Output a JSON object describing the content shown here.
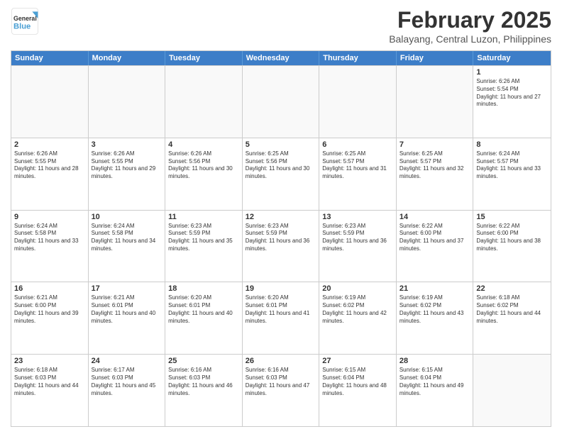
{
  "header": {
    "logo_general": "General",
    "logo_blue": "Blue",
    "main_title": "February 2025",
    "subtitle": "Balayang, Central Luzon, Philippines"
  },
  "days_of_week": [
    "Sunday",
    "Monday",
    "Tuesday",
    "Wednesday",
    "Thursday",
    "Friday",
    "Saturday"
  ],
  "weeks": [
    [
      {
        "day": "",
        "info": ""
      },
      {
        "day": "",
        "info": ""
      },
      {
        "day": "",
        "info": ""
      },
      {
        "day": "",
        "info": ""
      },
      {
        "day": "",
        "info": ""
      },
      {
        "day": "",
        "info": ""
      },
      {
        "day": "1",
        "info": "Sunrise: 6:26 AM\nSunset: 5:54 PM\nDaylight: 11 hours and 27 minutes."
      }
    ],
    [
      {
        "day": "2",
        "info": "Sunrise: 6:26 AM\nSunset: 5:55 PM\nDaylight: 11 hours and 28 minutes."
      },
      {
        "day": "3",
        "info": "Sunrise: 6:26 AM\nSunset: 5:55 PM\nDaylight: 11 hours and 29 minutes."
      },
      {
        "day": "4",
        "info": "Sunrise: 6:26 AM\nSunset: 5:56 PM\nDaylight: 11 hours and 30 minutes."
      },
      {
        "day": "5",
        "info": "Sunrise: 6:25 AM\nSunset: 5:56 PM\nDaylight: 11 hours and 30 minutes."
      },
      {
        "day": "6",
        "info": "Sunrise: 6:25 AM\nSunset: 5:57 PM\nDaylight: 11 hours and 31 minutes."
      },
      {
        "day": "7",
        "info": "Sunrise: 6:25 AM\nSunset: 5:57 PM\nDaylight: 11 hours and 32 minutes."
      },
      {
        "day": "8",
        "info": "Sunrise: 6:24 AM\nSunset: 5:57 PM\nDaylight: 11 hours and 33 minutes."
      }
    ],
    [
      {
        "day": "9",
        "info": "Sunrise: 6:24 AM\nSunset: 5:58 PM\nDaylight: 11 hours and 33 minutes."
      },
      {
        "day": "10",
        "info": "Sunrise: 6:24 AM\nSunset: 5:58 PM\nDaylight: 11 hours and 34 minutes."
      },
      {
        "day": "11",
        "info": "Sunrise: 6:23 AM\nSunset: 5:59 PM\nDaylight: 11 hours and 35 minutes."
      },
      {
        "day": "12",
        "info": "Sunrise: 6:23 AM\nSunset: 5:59 PM\nDaylight: 11 hours and 36 minutes."
      },
      {
        "day": "13",
        "info": "Sunrise: 6:23 AM\nSunset: 5:59 PM\nDaylight: 11 hours and 36 minutes."
      },
      {
        "day": "14",
        "info": "Sunrise: 6:22 AM\nSunset: 6:00 PM\nDaylight: 11 hours and 37 minutes."
      },
      {
        "day": "15",
        "info": "Sunrise: 6:22 AM\nSunset: 6:00 PM\nDaylight: 11 hours and 38 minutes."
      }
    ],
    [
      {
        "day": "16",
        "info": "Sunrise: 6:21 AM\nSunset: 6:00 PM\nDaylight: 11 hours and 39 minutes."
      },
      {
        "day": "17",
        "info": "Sunrise: 6:21 AM\nSunset: 6:01 PM\nDaylight: 11 hours and 40 minutes."
      },
      {
        "day": "18",
        "info": "Sunrise: 6:20 AM\nSunset: 6:01 PM\nDaylight: 11 hours and 40 minutes."
      },
      {
        "day": "19",
        "info": "Sunrise: 6:20 AM\nSunset: 6:01 PM\nDaylight: 11 hours and 41 minutes."
      },
      {
        "day": "20",
        "info": "Sunrise: 6:19 AM\nSunset: 6:02 PM\nDaylight: 11 hours and 42 minutes."
      },
      {
        "day": "21",
        "info": "Sunrise: 6:19 AM\nSunset: 6:02 PM\nDaylight: 11 hours and 43 minutes."
      },
      {
        "day": "22",
        "info": "Sunrise: 6:18 AM\nSunset: 6:02 PM\nDaylight: 11 hours and 44 minutes."
      }
    ],
    [
      {
        "day": "23",
        "info": "Sunrise: 6:18 AM\nSunset: 6:03 PM\nDaylight: 11 hours and 44 minutes."
      },
      {
        "day": "24",
        "info": "Sunrise: 6:17 AM\nSunset: 6:03 PM\nDaylight: 11 hours and 45 minutes."
      },
      {
        "day": "25",
        "info": "Sunrise: 6:16 AM\nSunset: 6:03 PM\nDaylight: 11 hours and 46 minutes."
      },
      {
        "day": "26",
        "info": "Sunrise: 6:16 AM\nSunset: 6:03 PM\nDaylight: 11 hours and 47 minutes."
      },
      {
        "day": "27",
        "info": "Sunrise: 6:15 AM\nSunset: 6:04 PM\nDaylight: 11 hours and 48 minutes."
      },
      {
        "day": "28",
        "info": "Sunrise: 6:15 AM\nSunset: 6:04 PM\nDaylight: 11 hours and 49 minutes."
      },
      {
        "day": "",
        "info": ""
      }
    ]
  ]
}
